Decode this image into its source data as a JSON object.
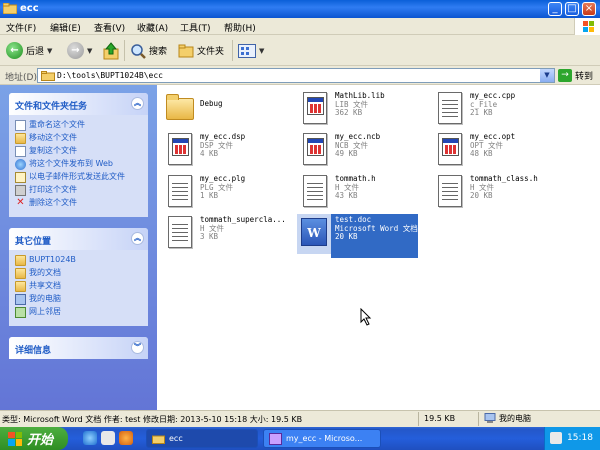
{
  "window": {
    "title": "ecc",
    "buttons": {
      "minimize": "_",
      "maximize": "□",
      "close": "×"
    }
  },
  "menu": [
    "文件(F)",
    "编辑(E)",
    "查看(V)",
    "收藏(A)",
    "工具(T)",
    "帮助(H)"
  ],
  "toolbar": {
    "back": "后退",
    "search": "搜索",
    "folders": "文件夹"
  },
  "address": {
    "label": "地址(D)",
    "path": "D:\\tools\\BUPT1024B\\ecc",
    "go": "转到"
  },
  "tasks_panel": {
    "title": "文件和文件夹任务",
    "items": [
      {
        "label": "重命名这个文件",
        "icon": "rename-icon"
      },
      {
        "label": "移动这个文件",
        "icon": "move-icon"
      },
      {
        "label": "复制这个文件",
        "icon": "copy-icon"
      },
      {
        "label": "将这个文件发布到 Web",
        "icon": "globe-icon"
      },
      {
        "label": "以电子邮件形式发送此文件",
        "icon": "mail-icon"
      },
      {
        "label": "打印这个文件",
        "icon": "print-icon"
      },
      {
        "label": "删除这个文件",
        "icon": "delete-icon"
      }
    ]
  },
  "places_panel": {
    "title": "其它位置",
    "items": [
      {
        "label": "BUPT1024B",
        "icon": "folder-icon"
      },
      {
        "label": "我的文档",
        "icon": "folder-icon"
      },
      {
        "label": "共享文档",
        "icon": "folder-icon"
      },
      {
        "label": "我的电脑",
        "icon": "computer-icon"
      },
      {
        "label": "网上邻居",
        "icon": "network-icon"
      }
    ]
  },
  "details_panel": {
    "title": "详细信息"
  },
  "files": [
    {
      "name": "Debug",
      "type": "",
      "size": "",
      "icon": "folder-icon"
    },
    {
      "name": "MathLib.lib",
      "type": "LIB 文件",
      "size": "362 KB",
      "icon": "window-file-icon"
    },
    {
      "name": "my_ecc.cpp",
      "type": "c_File",
      "size": "21 KB",
      "icon": "text-file-icon"
    },
    {
      "name": "my_ecc.dsp",
      "type": "DSP 文件",
      "size": "4 KB",
      "icon": "window-file-icon"
    },
    {
      "name": "my_ecc.ncb",
      "type": "NCB 文件",
      "size": "49 KB",
      "icon": "window-file-icon"
    },
    {
      "name": "my_ecc.opt",
      "type": "OPT 文件",
      "size": "48 KB",
      "icon": "window-file-icon"
    },
    {
      "name": "my_ecc.plg",
      "type": "PLG 文件",
      "size": "1 KB",
      "icon": "text-file-icon"
    },
    {
      "name": "tommath.h",
      "type": "H 文件",
      "size": "43 KB",
      "icon": "text-file-icon"
    },
    {
      "name": "tommath_class.h",
      "type": "H 文件",
      "size": "20 KB",
      "icon": "text-file-icon"
    },
    {
      "name": "tommath_supercla...",
      "type": "H 文件",
      "size": "3 KB",
      "icon": "text-file-icon"
    },
    {
      "name": "test.doc",
      "type": "Microsoft Word 文档",
      "size": "20 KB",
      "icon": "word-doc-icon",
      "selected": true
    }
  ],
  "status": {
    "info": "类型: Microsoft Word 文档 作者: test 修改日期: 2013-5-10 15:18 大小: 19.5 KB",
    "size": "19.5 KB",
    "location": "我的电脑"
  },
  "taskbar": {
    "start": "开始",
    "tasks": [
      {
        "label": "ecc",
        "active": true
      },
      {
        "label": "my_ecc - Microso...",
        "active": false
      }
    ],
    "clock": "15:18"
  }
}
